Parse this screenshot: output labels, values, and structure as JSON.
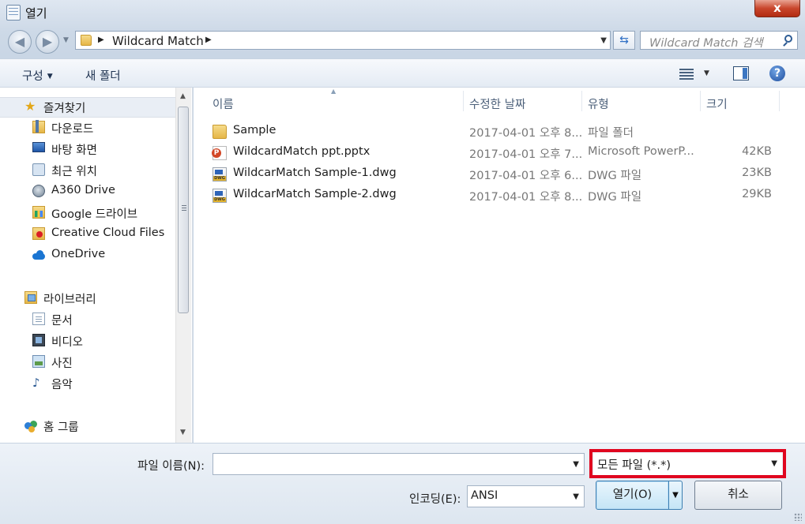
{
  "window": {
    "title": "열기",
    "close_label": "x"
  },
  "address": {
    "path": [
      "Wildcard Match"
    ]
  },
  "search": {
    "placeholder": "Wildcard Match 검색"
  },
  "toolbar": {
    "organize": "구성",
    "new_folder": "새 폴더"
  },
  "nav": {
    "favorites_header": "즐겨찾기",
    "favorites": [
      {
        "label": "다운로드",
        "icon": "download-folder-icon"
      },
      {
        "label": "바탕 화면",
        "icon": "desktop-icon"
      },
      {
        "label": "최근 위치",
        "icon": "recent-places-icon"
      },
      {
        "label": "A360 Drive",
        "icon": "a360-drive-icon"
      },
      {
        "label": "Google 드라이브",
        "icon": "google-drive-icon"
      },
      {
        "label": "Creative Cloud Files",
        "icon": "creative-cloud-icon"
      },
      {
        "label": "OneDrive",
        "icon": "onedrive-icon"
      }
    ],
    "libraries_header": "라이브러리",
    "libraries": [
      {
        "label": "문서",
        "icon": "documents-icon"
      },
      {
        "label": "비디오",
        "icon": "videos-icon"
      },
      {
        "label": "사진",
        "icon": "pictures-icon"
      },
      {
        "label": "음악",
        "icon": "music-icon"
      }
    ],
    "homegroup": "홈 그룹"
  },
  "columns": {
    "name": "이름",
    "date": "수정한 날짜",
    "type": "유형",
    "size": "크기"
  },
  "files": [
    {
      "name": "Sample",
      "date": "2017-04-01 오후 8...",
      "type": "파일 폴더",
      "size": "",
      "icon": "folder-icon"
    },
    {
      "name": "WildcardMatch ppt.pptx",
      "date": "2017-04-01 오후 7...",
      "type": "Microsoft PowerP...",
      "size": "42KB",
      "icon": "powerpoint-file-icon"
    },
    {
      "name": "WildcarMatch Sample-1.dwg",
      "date": "2017-04-01 오후 6...",
      "type": "DWG 파일",
      "size": "23KB",
      "icon": "dwg-file-icon"
    },
    {
      "name": "WildcarMatch Sample-2.dwg",
      "date": "2017-04-01 오후 8...",
      "type": "DWG 파일",
      "size": "29KB",
      "icon": "dwg-file-icon"
    }
  ],
  "bottom": {
    "filename_label": "파일 이름(N):",
    "filename_value": "",
    "filetype_value": "모든 파일 (*.*)",
    "encoding_label": "인코딩(E):",
    "encoding_value": "ANSI",
    "open_label": "열기(O)",
    "cancel_label": "취소"
  },
  "colors": {
    "highlight": "#e0061f",
    "accent": "#3c7fb1"
  }
}
